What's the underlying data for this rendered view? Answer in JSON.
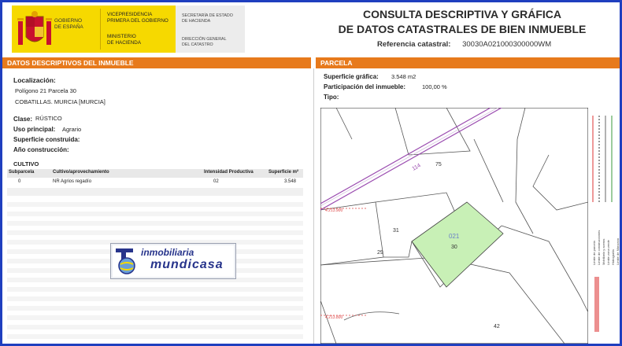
{
  "header": {
    "gobierno": [
      "GOBIERNO",
      "DE ESPAÑA"
    ],
    "org_vice": [
      "VICEPRESIDENCIA",
      "PRIMERA DEL GOBIERNO"
    ],
    "org_min": [
      "MINISTERIO",
      "DE HACIENDA"
    ],
    "org_sec": [
      "SECRETARÍA DE ESTADO",
      "DE HACIENDA"
    ],
    "org_dir": [
      "DIRECCIÓN GENERAL",
      "DEL CATASTRO"
    ],
    "title_line1": "CONSULTA DESCRIPTIVA Y GRÁFICA",
    "title_line2": "DE DATOS CATASTRALES DE BIEN INMUEBLE",
    "ref_label": "Referencia catastral:",
    "ref_value": "30030A021000300000WM",
    "colors": {
      "accent": "#e77a1c",
      "gov_yellow": "#f6d900",
      "border": "#1f3fbf"
    }
  },
  "left": {
    "section_title": "DATOS DESCRIPTIVOS DEL INMUEBLE",
    "loc_label": "Localización:",
    "loc_line1": "Polígono 21 Parcela 30",
    "loc_line2": "COBATILLAS. MURCIA [MURCIA]",
    "clase_label": "Clase:",
    "clase_value": "RÚSTICO",
    "uso_label": "Uso principal:",
    "uso_value": "Agrario",
    "sup_label": "Superficie construida:",
    "anio_label": "Año construcción:",
    "cultivo_title": "CULTIVO",
    "table": {
      "headers": [
        "Subparcela",
        "Cultivo/aprovechamiento",
        "Intensidad Productiva",
        "Superficie m²"
      ],
      "rows": [
        [
          "0",
          "NR Agrios regadío",
          "02",
          "3.548"
        ]
      ]
    },
    "logo_line1": "inmobiliaria",
    "logo_line2": "mundicasa"
  },
  "right": {
    "section_title": "PARCELA",
    "sup_label": "Superficie gráfica:",
    "sup_value": "3.548 m2",
    "part_label": "Participación del inmueble:",
    "part_value": "100,00 %",
    "tipo_label": "Tipo:",
    "map_labels": {
      "road": "114",
      "p75": "75",
      "p31": "31",
      "p29": "29",
      "sub": "021",
      "p30": "30",
      "p42": "42",
      "coord1": "4.213.900",
      "coord2": "4.213.800"
    },
    "legend": [
      "Límite de parcela",
      "Límite de construcciones",
      "Mobiliario y aceras",
      "Límite zona verde",
      "Hidrografía",
      "Límite de Manzana"
    ]
  }
}
